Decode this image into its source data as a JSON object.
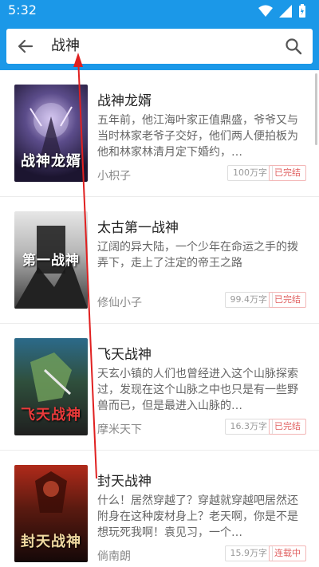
{
  "status_bar": {
    "time": "5:32"
  },
  "search": {
    "query": "战神"
  },
  "books": [
    {
      "title": "战神龙婿",
      "description": "五年前，他江海叶家正值鼎盛，爷爷又与当时林家老爷子交好，他们两人便拍板为他和林家林清月定下婚约，…",
      "author": "小枳子",
      "word_count": "100万字",
      "status": "已完结",
      "cover_text": "战神龙婿"
    },
    {
      "title": "太古第一战神",
      "description": "辽阔的异大陆，一个少年在命运之手的拨弄下，走上了注定的帝王之路",
      "author": "修仙小子",
      "word_count": "99.4万字",
      "status": "已完结",
      "cover_text": "第一战神"
    },
    {
      "title": "飞天战神",
      "description": "天玄小镇的人们也曾经进入这个山脉探索过，发现在这个山脉之中也只是有一些野兽而已，但是最进入山脉的…",
      "author": "摩米天下",
      "word_count": "16.3万字",
      "status": "已完结",
      "cover_text": "飞天战神"
    },
    {
      "title": "封天战神",
      "description": "什么！居然穿越了？穿越就穿越吧居然还附身在这种废材身上？老天啊，你是不是想玩死我啊！袁见习，一个…",
      "author": "倘南朗",
      "word_count": "15.9万字",
      "status": "连载中",
      "cover_text": "封天战神"
    }
  ],
  "colors": {
    "header": "#1b98e8",
    "status_done": "#e06060",
    "annotation_arrow": "#e02020"
  }
}
